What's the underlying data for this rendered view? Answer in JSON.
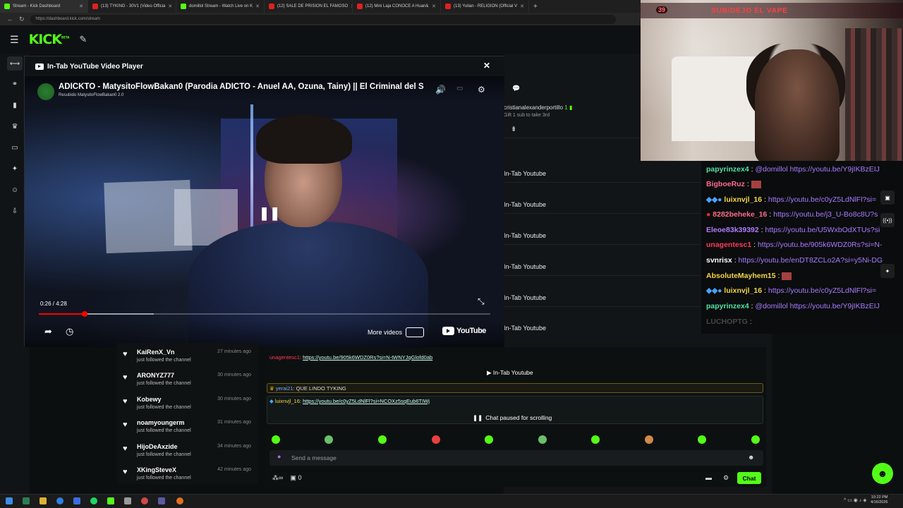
{
  "browser": {
    "tabs": [
      {
        "label": "Stream - Kick Dashboard",
        "icon": "kick-icon",
        "active": true
      },
      {
        "label": "(13) TYKING - 30V1 (Video Officia",
        "icon": "youtube-icon"
      },
      {
        "label": "domillol Stream - Watch Live on K",
        "icon": "kick-icon"
      },
      {
        "label": "(12) SALE DE PRISION EL FAMOSO",
        "icon": "youtube-icon"
      },
      {
        "label": "(12) Mini Laja CONOCE A Huan&",
        "icon": "youtube-icon"
      },
      {
        "label": "(13) Yulian - RELIGION (Official V",
        "icon": "youtube-icon"
      }
    ],
    "url": "https://dashboard.kick.com/stream"
  },
  "kick": {
    "logo": "KICK",
    "logo_badge": "BETA"
  },
  "player": {
    "header": "In-Tab YouTube Video Player",
    "video_title": "ADICKTO - MatysitoFlowBakan0 (Parodia ADICTO - Anuel AA, Ozuna, Tainy) || El Criminal del S",
    "channel_line": "Resubido MatysitoFlowBakan0 2.0",
    "time": "0:26 / 4:28",
    "progress_played": 0.101,
    "progress_buffered": 0.255,
    "more_videos": "More videos",
    "yt_logo": "YouTube"
  },
  "dashboard": {
    "cristian_name": "cristianalexanderportillo",
    "cristian_sub": "Gift 1 sub to take 3rd",
    "tab_items": [
      "In-Tab Youtube",
      "In-Tab Youtube",
      "In-Tab Youtube",
      "In-Tab Youtube",
      "In-Tab Youtube",
      "In-Tab Youtube"
    ],
    "followers": [
      {
        "name": "KaiRenX_Vn",
        "action": "just followed the channel",
        "time": "27 minutes ago"
      },
      {
        "name": "ARONYZ777",
        "action": "just followed the channel",
        "time": "30 minutes ago"
      },
      {
        "name": "Kobewy",
        "action": "just followed the channel",
        "time": "30 minutes ago"
      },
      {
        "name": "noamyoungerm",
        "action": "just followed the channel",
        "time": "31 minutes ago"
      },
      {
        "name": "HijoDeAxzide",
        "action": "just followed the channel",
        "time": "34 minutes ago"
      },
      {
        "name": "XKingSteveX",
        "action": "just followed the channel",
        "time": "42 minutes ago"
      }
    ],
    "chat": {
      "msg1_user": "unagentesc1",
      "msg1_link": "https://youtu.be/905k6WDZ0Rs?si=N-tWNYJqGlofd0ab",
      "in_tab_label": "In-Tab Youtube",
      "msg2_user": "yerai21",
      "msg2_text": "QUE LINDO TYKING",
      "msg3_user": "luixnvjl_16",
      "msg3_link": "https://youtu.be/c0yZ5LdNlFl?si=NCOXz5sqEub6TIWj",
      "paused": "Chat paused for scrolling",
      "send_placeholder": "Send a message",
      "points": "0",
      "chat_button": "Chat"
    }
  },
  "webcam": {
    "sub_count": "39",
    "banner": "SUB/DEJO EL VAPE"
  },
  "overlay_chat": [
    {
      "user": "papyrinzex4",
      "color": "#54e1a6",
      "text": "@domillol https://youtu.be/Y9jIKBzEIJ"
    },
    {
      "user": "BigboeRuz",
      "color": "#ff6a8e",
      "text": ""
    },
    {
      "user": "luixnvjl_16",
      "color": "#f5d547",
      "text": "https://youtu.be/c0yZ5LdNlFl?si="
    },
    {
      "user": "8282beheke_16",
      "color": "#ff6a8e",
      "text": "https://youtu.be/j3_U-Bo8c8U?s"
    },
    {
      "user": "Eleoe83k39392",
      "color": "#b07cff",
      "text": "https://youtu.be/U5WxbOdXTUs?si"
    },
    {
      "user": "unagentesc1",
      "color": "#ff3a5a",
      "text": "https://youtu.be/905k6WDZ0Rs?si=N-"
    },
    {
      "user": "svnrisx",
      "color": "#ffffff",
      "text": "https://youtu.be/enDT8ZCLo2A?si=y5Ni-DG"
    },
    {
      "user": "AbsoluteMayhem15",
      "color": "#f5d547",
      "text": ""
    },
    {
      "user": "luixnvjl_16",
      "color": "#f5d547",
      "text": "https://youtu.be/c0yZ5LdNlFl?si="
    },
    {
      "user": "papyrinzex4",
      "color": "#54e1a6",
      "text": "@domillol https://youtu.be/Y9jIKBzEIJ"
    },
    {
      "user": "LUCHOPTG",
      "color": "#777777",
      "text": ""
    }
  ],
  "taskbar": {
    "clock_time": "10:22 PM",
    "clock_date": "4/16/2026"
  },
  "colors": {
    "kick_green": "#53fc18",
    "link_purple": "#a97bff",
    "progress_red": "#ff0000"
  }
}
